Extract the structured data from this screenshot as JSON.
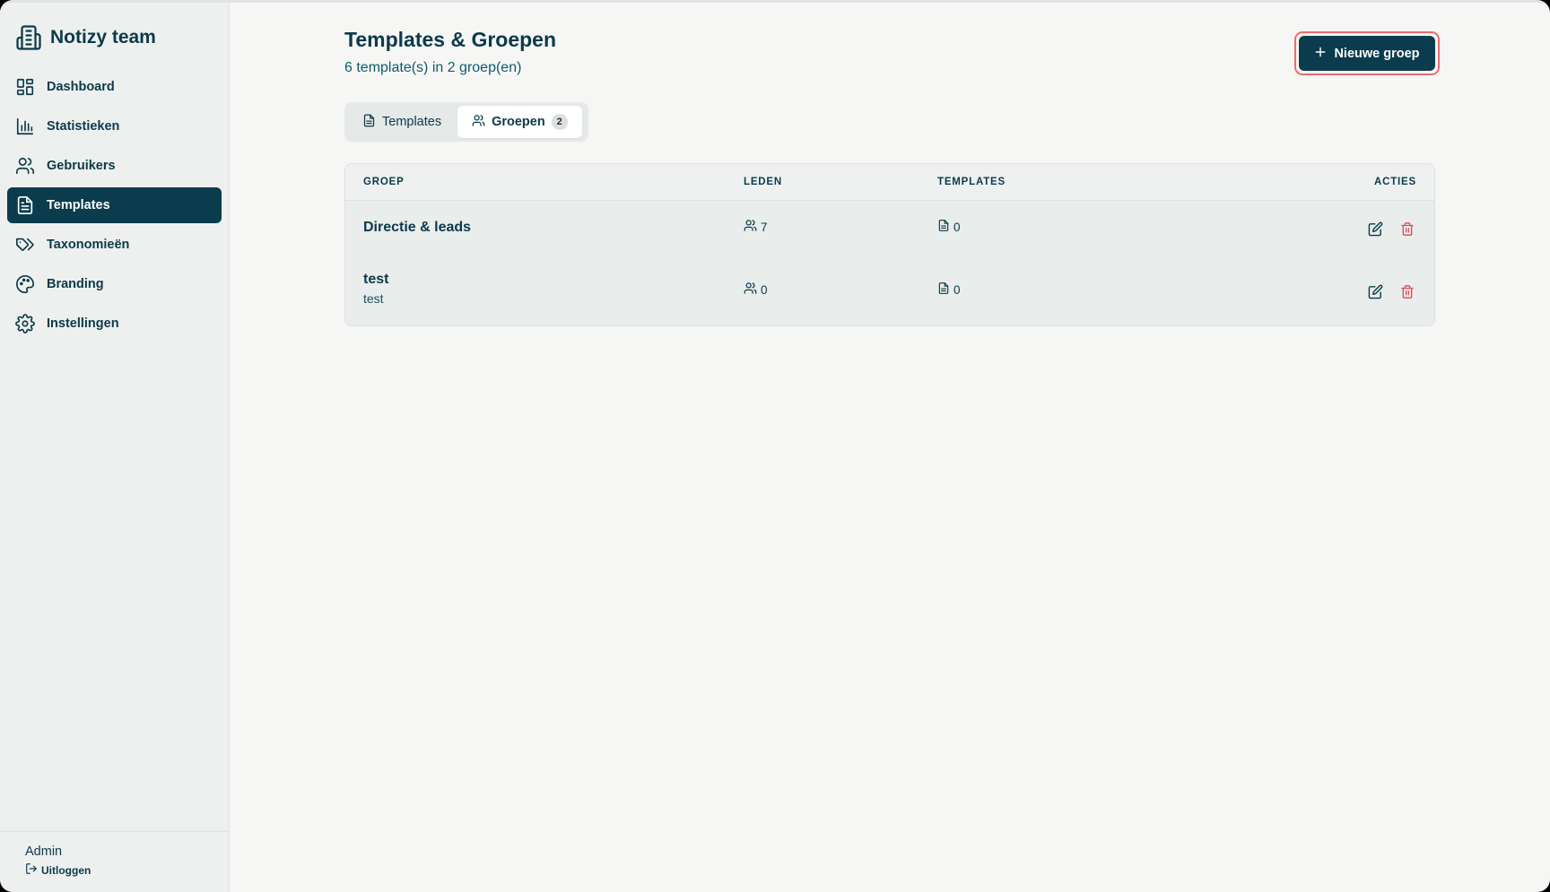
{
  "app": {
    "title": "Notizy team"
  },
  "sidebar": {
    "items": [
      {
        "label": "Dashboard",
        "icon": "dashboard-icon"
      },
      {
        "label": "Statistieken",
        "icon": "bar-chart-icon"
      },
      {
        "label": "Gebruikers",
        "icon": "users-icon"
      },
      {
        "label": "Templates",
        "icon": "document-icon",
        "active": true
      },
      {
        "label": "Taxonomieën",
        "icon": "tags-icon"
      },
      {
        "label": "Branding",
        "icon": "palette-icon"
      },
      {
        "label": "Instellingen",
        "icon": "gear-icon"
      }
    ],
    "footer": {
      "user": "Admin",
      "logout": "Uitloggen"
    }
  },
  "header": {
    "title": "Templates & Groepen",
    "subtitle": "6 template(s) in 2 groep(en)",
    "new_button": "Nieuwe groep"
  },
  "tabs": [
    {
      "label": "Templates"
    },
    {
      "label": "Groepen",
      "badge": "2",
      "active": true
    }
  ],
  "table": {
    "columns": {
      "group": "GROEP",
      "members": "LEDEN",
      "templates": "TEMPLATES",
      "actions": "ACTIES"
    },
    "rows": [
      {
        "name": "Directie & leads",
        "description": "",
        "members": "7",
        "templates": "0"
      },
      {
        "name": "test",
        "description": "test",
        "members": "0",
        "templates": "0"
      }
    ]
  },
  "colors": {
    "primary": "#0b3c4d",
    "danger": "#e5484d",
    "highlight": "#f06a6a"
  }
}
